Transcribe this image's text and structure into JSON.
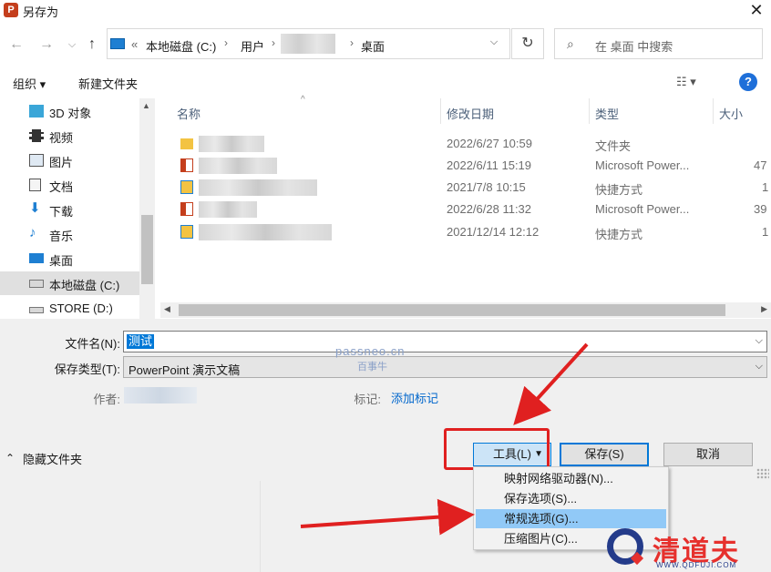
{
  "window": {
    "title": "另存为",
    "app_icon": "P",
    "close_label": "✕"
  },
  "nav": {
    "back": "←",
    "forward": "→",
    "dropdown": "⌵",
    "up": "↑"
  },
  "address": {
    "prefix": "«",
    "crumbs": [
      "本地磁盘 (C:)",
      "用户",
      "桌面"
    ],
    "sep": "›",
    "dropdown": "⌵",
    "refresh": "↻"
  },
  "search": {
    "icon": "⌕",
    "placeholder": "在 桌面 中搜索"
  },
  "toolbar": {
    "organize": "组织 ▾",
    "new_folder": "新建文件夹",
    "view": "☷ ▾",
    "help": "?"
  },
  "sidebar": {
    "items": [
      {
        "label": "3D 对象",
        "icon": "cube-icon",
        "color": "#3aa6d8"
      },
      {
        "label": "视频",
        "icon": "film-icon",
        "color": "#333333"
      },
      {
        "label": "图片",
        "icon": "picture-icon",
        "color": "#555555"
      },
      {
        "label": "文档",
        "icon": "document-icon",
        "color": "#555555"
      },
      {
        "label": "下载",
        "icon": "download-icon",
        "color": "#1e7fd2"
      },
      {
        "label": "音乐",
        "icon": "music-icon",
        "color": "#1e7fd2"
      },
      {
        "label": "桌面",
        "icon": "desktop-icon",
        "color": "#1e7fd2"
      },
      {
        "label": "本地磁盘 (C:)",
        "icon": "drive-icon",
        "color": "#666666",
        "selected": true
      },
      {
        "label": "STORE (D:)",
        "icon": "drive-icon",
        "color": "#666666"
      }
    ]
  },
  "filelist": {
    "columns": [
      "名称",
      "修改日期",
      "类型",
      "大小"
    ],
    "sort_indicator": "^",
    "rows": [
      {
        "icon": "folder-icon",
        "date": "2022/6/27 10:59",
        "type": "文件夹",
        "size": ""
      },
      {
        "icon": "pptx-icon",
        "date": "2022/6/11 15:19",
        "type": "Microsoft Power...",
        "size": "47"
      },
      {
        "icon": "shortcut-icon",
        "date": "2021/7/8 10:15",
        "type": "快捷方式",
        "size": "1"
      },
      {
        "icon": "pptx-icon",
        "date": "2022/6/28 11:32",
        "type": "Microsoft Power...",
        "size": "39"
      },
      {
        "icon": "shortcut-icon",
        "date": "2021/12/14 12:12",
        "type": "快捷方式",
        "size": "1"
      }
    ]
  },
  "form": {
    "filename_label": "文件名(N):",
    "filename_value": "测试",
    "filetype_label": "保存类型(T):",
    "filetype_value": "PowerPoint 演示文稿",
    "author_label": "作者:",
    "tags_label": "标记:",
    "tags_link": "添加标记"
  },
  "watermark": {
    "line1": "passneo.cn",
    "line2": "百事牛"
  },
  "footer": {
    "hide_folders": "隐藏文件夹",
    "tools": "工具(L)",
    "save": "保存(S)",
    "cancel": "取消"
  },
  "menu": {
    "items": [
      "映射网络驱动器(N)...",
      "保存选项(S)...",
      "常规选项(G)...",
      "压缩图片(C)..."
    ],
    "highlighted": 2
  },
  "logo": {
    "brand": "清道夫",
    "url": "WWW.QDFUJI.COM"
  },
  "colors": {
    "accent": "#0078d7",
    "annotation_red": "#e02020",
    "menu_highlight": "#91c9f7"
  }
}
